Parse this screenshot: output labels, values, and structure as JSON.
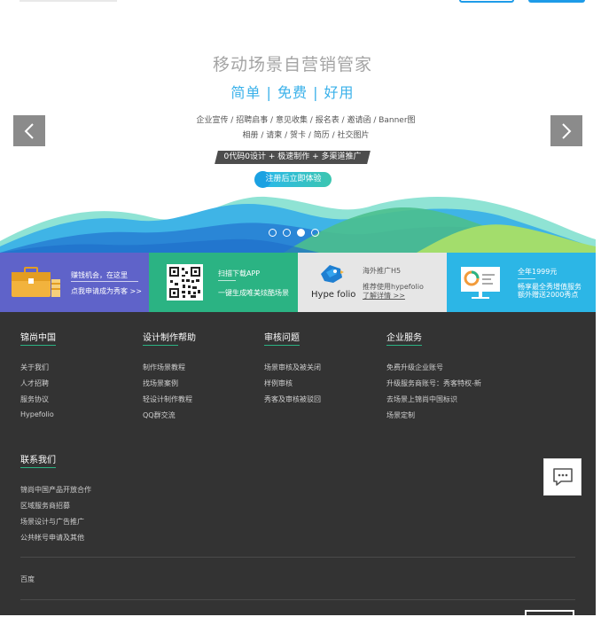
{
  "hero": {
    "title": "移动场景自营销管家",
    "subtitle": "简单 | 免费 | 好用",
    "line1": "企业宣传 / 招聘启事 / 意见收集 / 报名表 / 邀请函 / Banner图",
    "line2": "相册 / 请柬 / 贺卡 / 简历 / 社交图片",
    "tags": "0代码0设计 + 极速制作 + 多渠道推广",
    "cta": "注册后立即体验",
    "slide_count": 4,
    "active_slide": 3,
    "wave_colors": [
      "#7fdcd8",
      "#3fb4e6",
      "#2b8ad6",
      "#4ac08a",
      "#9fdc6a"
    ]
  },
  "promos": [
    {
      "line1": "赚钱机会，在这里",
      "line2": "点我申请成为秀客 >>",
      "color": "#5f63c9"
    },
    {
      "line1": "扫描下载APP",
      "line2": "一键生成唯美炫酷场景",
      "color": "#2bb383"
    },
    {
      "brand": "Hype folio",
      "line1": "海外推广H5",
      "line2": "推荐使用hypefolio",
      "line3": "了解详情 >>",
      "color": "#e6e6e6"
    },
    {
      "line1": "全年1999元",
      "line2": "畅享最全秀增值服务",
      "line3": "额外赠送2000秀点",
      "color": "#2cb6e6"
    }
  ],
  "footer": {
    "columns": [
      {
        "title": "锦尚中国",
        "links": [
          "关于我们",
          "人才招聘",
          "服务协议",
          "Hypefolio"
        ]
      },
      {
        "title": "设计制作帮助",
        "links": [
          "制作场景教程",
          "找场景案例",
          "轻设计制作教程",
          "QQ群交流"
        ]
      },
      {
        "title": "审核问题",
        "links": [
          "场景审核及被关闭",
          "样例审核",
          "秀客及审核被驳回"
        ]
      },
      {
        "title": "企业服务",
        "links": [
          "免费升级企业账号",
          "升级服务商账号：秀客特权-新",
          "去场景上锦尚中国标识",
          "场景定制"
        ]
      }
    ],
    "contact": {
      "title": "联系我们",
      "links": [
        "锦尚中国产品开放合作",
        "区域服务商招募",
        "场景设计与广告推广",
        "公共帐号申请及其他"
      ]
    },
    "friend_link": "百度"
  },
  "colors": {
    "accent": "#1e9be8",
    "footer_bg": "#333333",
    "underline": "#2bb383"
  }
}
